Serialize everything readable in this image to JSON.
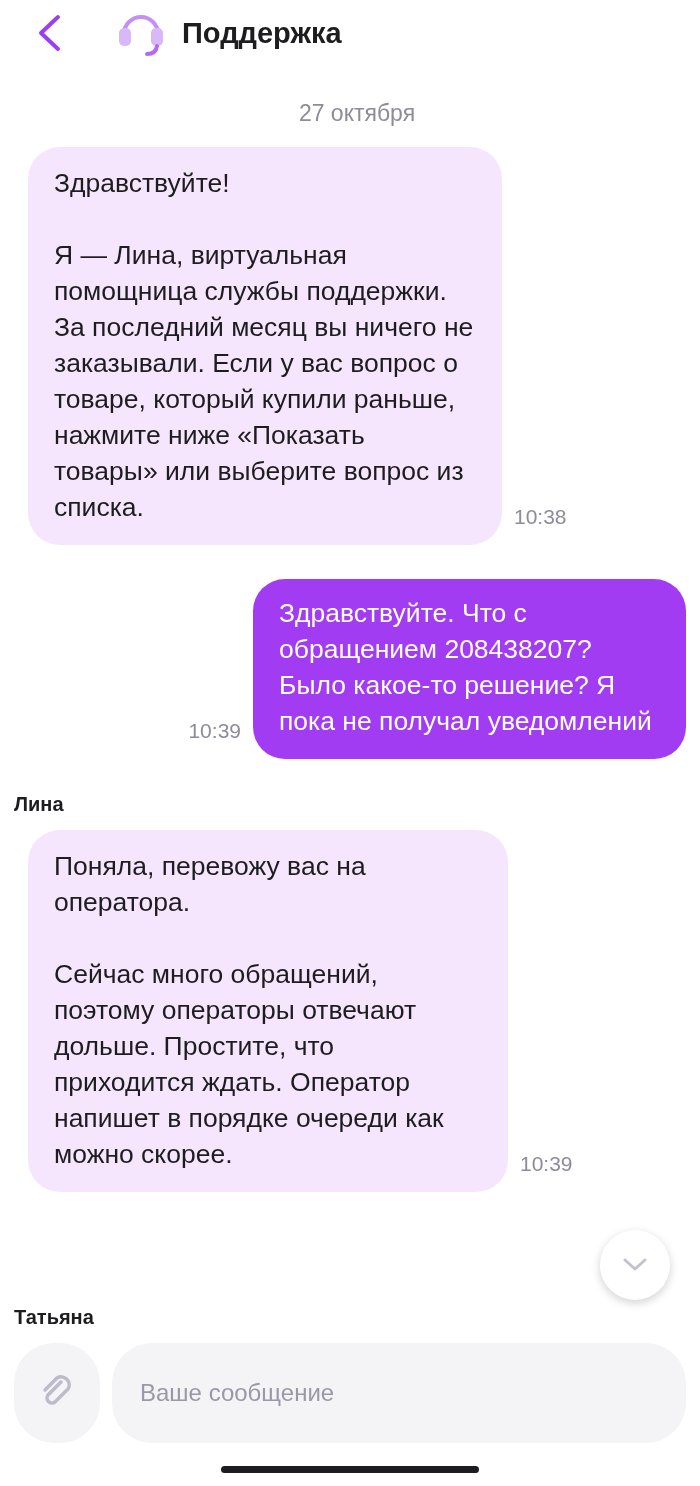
{
  "header": {
    "title": "Поддержка"
  },
  "date": "27 октября",
  "messages": [
    {
      "kind": "incoming",
      "paragraphs": [
        "Здравствуйте!",
        "Я — Лина, виртуальная помощница службы поддержки. За последний месяц вы ничего не заказывали. Если у вас вопрос о товаре, который купили раньше, нажмите ниже «Показать товары» или выберите вопрос из списка."
      ],
      "time": "10:38"
    },
    {
      "kind": "outgoing",
      "paragraphs": [
        "Здравствуйте. Что с обращением 208438207? Было какое-то решение? Я пока не получал уведомлений"
      ],
      "time": "10:39"
    },
    {
      "kind": "incoming",
      "sender": "Лина",
      "paragraphs": [
        "Поняла, перевожу вас на оператора.",
        "Сейчас много обращений, поэтому операторы отвечают дольше. Простите, что приходится ждать. Оператор напишет в порядке очереди как можно скорее."
      ],
      "time": "10:39"
    }
  ],
  "operator": "Татьяна",
  "composer": {
    "placeholder": "Ваше сообщение"
  }
}
